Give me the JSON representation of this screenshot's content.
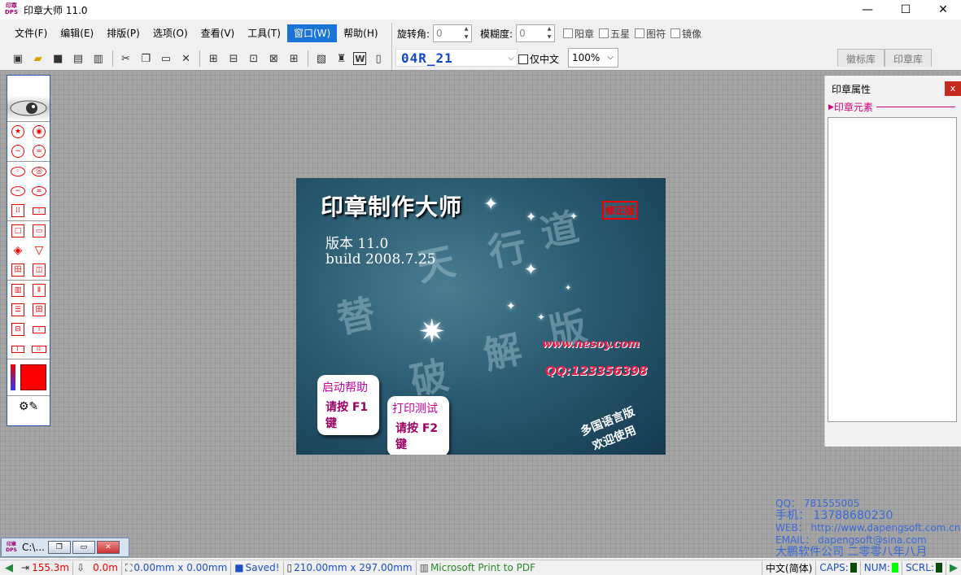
{
  "titlebar": {
    "icon_text": "印章\nDPS",
    "title": "印章大师 11.0",
    "minimize": "—",
    "maximize": "☐",
    "close": "✕"
  },
  "menu": [
    {
      "label": "文件(F)"
    },
    {
      "label": "编辑(E)"
    },
    {
      "label": "排版(P)"
    },
    {
      "label": "选项(O)"
    },
    {
      "label": "查看(V)"
    },
    {
      "label": "工具(T)"
    },
    {
      "label": "窗口(W)",
      "active": true
    },
    {
      "label": "帮助(H)"
    }
  ],
  "params": {
    "rotation_label": "旋转角:",
    "rotation_value": "0",
    "blur_label": "模糊度:",
    "blur_value": "0",
    "checks": [
      "阳章",
      "五星",
      "图符",
      "镜像"
    ]
  },
  "fontbar": {
    "font_value": "04R_21",
    "chinese_only_label": "仅中文",
    "zoom_value": "100%"
  },
  "right_tabs": [
    "徽标库",
    "印章库"
  ],
  "splash": {
    "title": "印章制作大师",
    "badge": "修正版",
    "version_line": "版本 11.0",
    "build_line": "build 2008.7.25",
    "watermark": [
      "替",
      "天",
      "行",
      "道",
      "破",
      "解",
      "版"
    ],
    "website": "www.nesoy.com",
    "qq": "QQ:123356398",
    "help_button": {
      "line1": "启动帮助",
      "line2": "请按 F1 键"
    },
    "print_button": {
      "line1": "打印测试",
      "line2": "请按 F2 键"
    },
    "multilang": {
      "line1": "多国语言版",
      "line2": "欢迎使用"
    }
  },
  "properties": {
    "title": "印章属性",
    "close": "x",
    "section": "印章元素"
  },
  "contact": {
    "qq": "QQ：  781555005",
    "mobile": "手机：  13788680230",
    "web": "WEB：  http://www.dapengsoft.com.cn",
    "email": "EMAIL：  dapengsoft@sina.com",
    "company": "大鹏软件公司  二零零八年八月"
  },
  "minimized_window": {
    "icon_text": "印章\nDPS",
    "title": "C:\\..."
  },
  "status": {
    "pos1": "155.3m",
    "pos2": "0.0m",
    "selection": "0.00mm x 0.00mm",
    "saved": "Saved!",
    "paper": "210.00mm x 297.00mm",
    "printer": "Microsoft Print to PDF",
    "ime": "中文(简体)",
    "caps": "CAPS:",
    "num": "NUM:",
    "scrl": "SCRL:"
  },
  "colors": {
    "accent": "#1a73d6",
    "stamp_red": "#ff0000",
    "contact_blue": "#3a6ad8",
    "status_blue": "#1c4fc4"
  }
}
